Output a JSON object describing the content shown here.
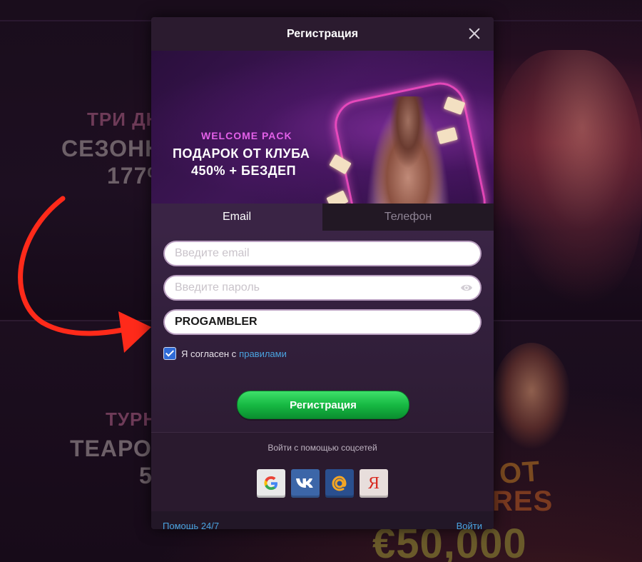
{
  "background": {
    "promo1": [
      "ТРИ ДН",
      "СЕЗОНН",
      "177%"
    ],
    "promo2": [
      "ТУРН",
      "ТЕАРОТ",
      "5"
    ],
    "promo3": [
      "OT",
      "RES",
      "€50,000"
    ]
  },
  "modal": {
    "title": "Регистрация",
    "banner": {
      "eyebrow": "WELCOME PACK",
      "title": "ПОДАРОК ОТ КЛУБА",
      "subtitle": "450% + БЕЗДЕП"
    },
    "tabs": [
      {
        "label": "Email",
        "active": true
      },
      {
        "label": "Телефон",
        "active": false
      }
    ],
    "form": {
      "email_placeholder": "Введите email",
      "password_placeholder": "Введите пароль",
      "promo_value": "PROGAMBLER",
      "agree_text": "Я согласен с",
      "rules_link": "правилами",
      "agree_checked": true,
      "submit_label": "Регистрация"
    },
    "social": {
      "caption": "Войти с помощью соцсетей",
      "providers": [
        "google",
        "vk",
        "mail-ru",
        "yandex"
      ]
    },
    "footer": {
      "help_link": "Помощь 24/7",
      "login_link": "Войти"
    }
  },
  "colors": {
    "accent_green": "#17b943",
    "link_blue": "#4aa3e0",
    "arrow_red": "#ff2a1a",
    "banner_pink": "#e260e8"
  }
}
